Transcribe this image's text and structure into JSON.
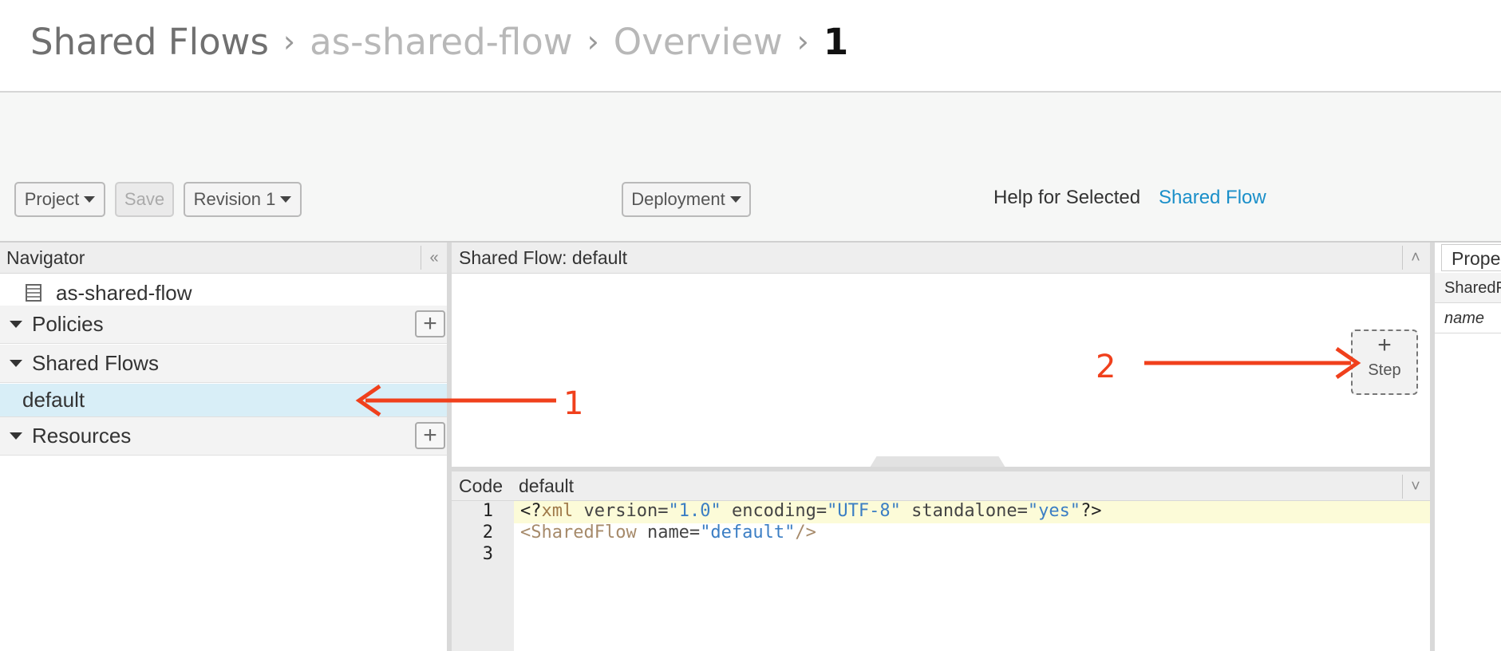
{
  "breadcrumb": {
    "items": [
      "Shared Flows",
      "as-shared-flow",
      "Overview",
      "1"
    ],
    "separator": "›"
  },
  "toolbar": {
    "project_label": "Project",
    "save_label": "Save",
    "revision_label": "Revision 1",
    "deployment_label": "Deployment",
    "help_label": "Help for Selected",
    "help_link": "Shared Flow"
  },
  "navigator": {
    "title": "Navigator",
    "collapse_glyph": "«",
    "root": "as-shared-flow",
    "policies": "Policies",
    "shared_flows": "Shared Flows",
    "selected_item": "default",
    "resources": "Resources",
    "add_glyph": "+"
  },
  "flow_panel": {
    "title": "Shared Flow: default",
    "collapse_glyph": "˄",
    "step_plus": "+",
    "step_label": "Step"
  },
  "code_panel": {
    "label": "Code",
    "file": "default",
    "expand_glyph": "˅",
    "line_numbers": [
      "1",
      "2",
      "3"
    ],
    "line1": {
      "open": "<?",
      "xml": "xml",
      "a1": " version=",
      "v1": "\"1.0\"",
      "a2": " encoding=",
      "v2": "\"UTF-8\"",
      "a3": " standalone=",
      "v3": "\"yes\"",
      "close": "?>"
    },
    "line2": {
      "tag": "<SharedFlow",
      "attr": " name=",
      "val": "\"default\"",
      "end": "/>"
    }
  },
  "properties": {
    "tab": "Properties",
    "row1": "SharedFlow",
    "row2": "name"
  },
  "annotations": {
    "one": "1",
    "two": "2",
    "color": "#f0401c"
  }
}
